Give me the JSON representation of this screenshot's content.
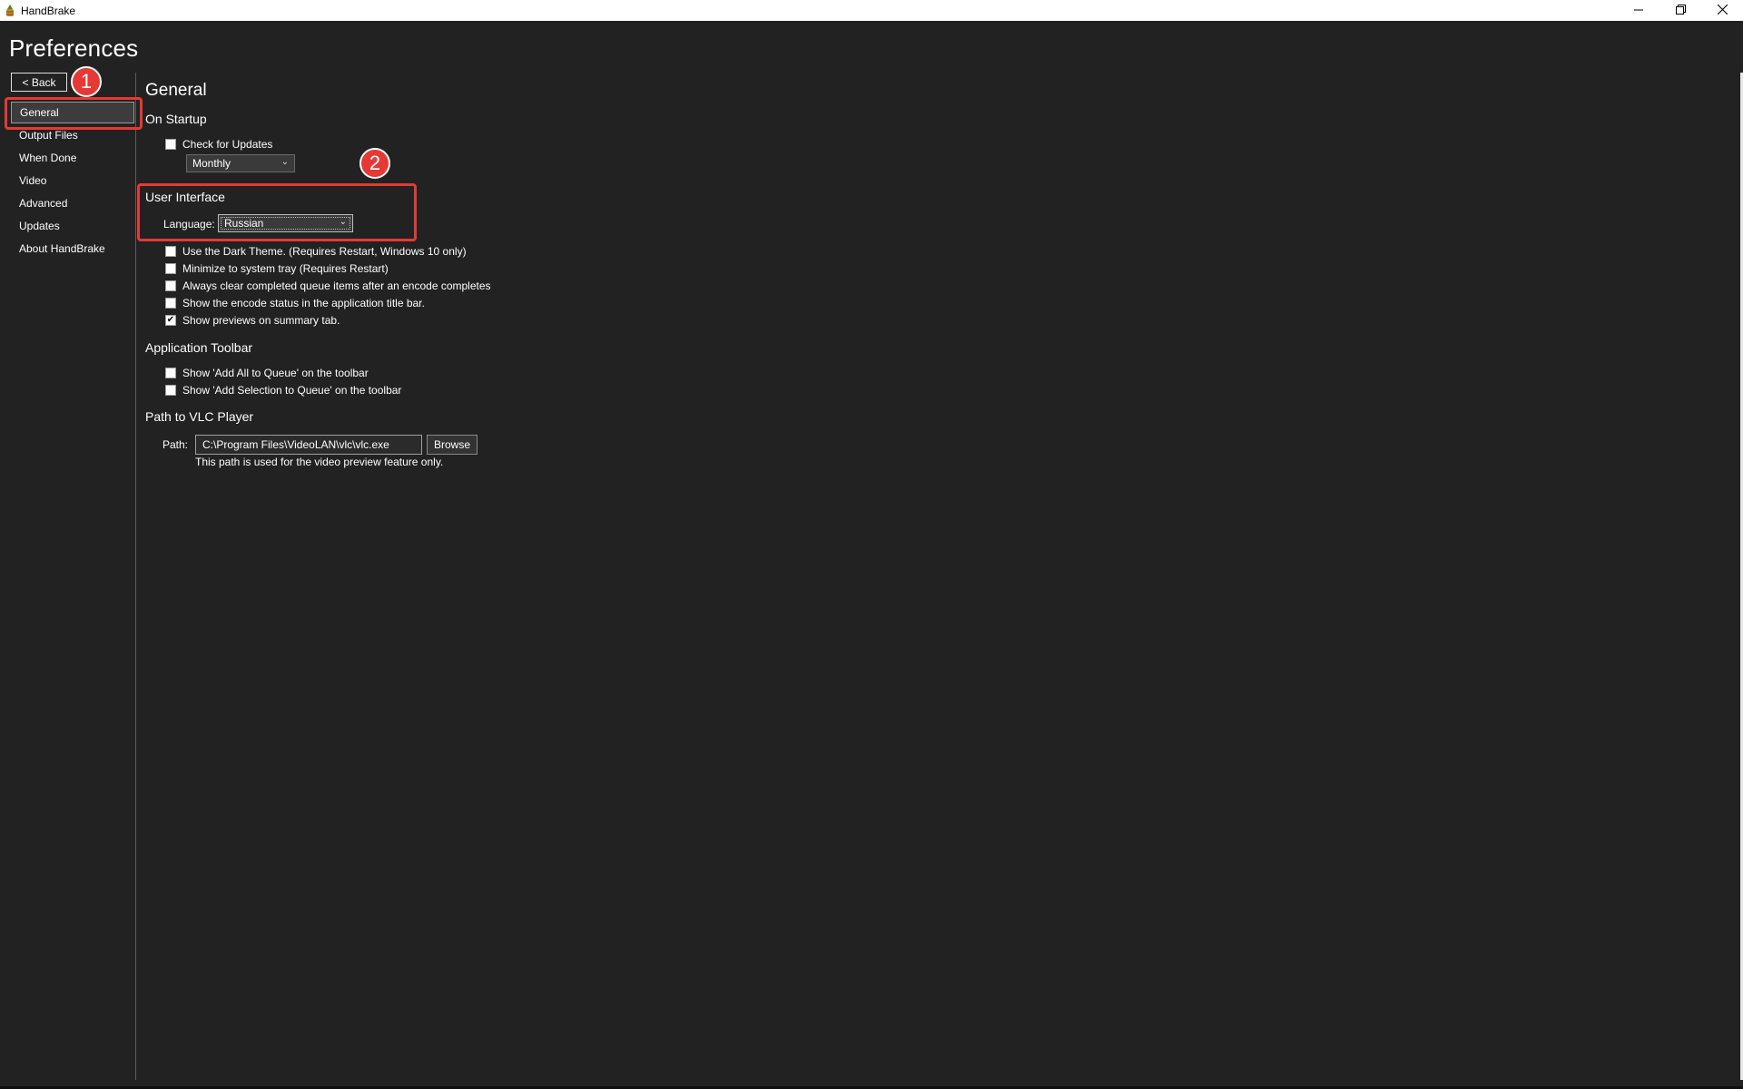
{
  "window": {
    "title": "HandBrake",
    "icon": "handbrake-pineapple-icon",
    "controls": {
      "minimize_icon": "minimize-icon",
      "restore_icon": "restore-icon",
      "close_icon": "close-icon"
    }
  },
  "page_title": "Preferences",
  "back_label": "< Back",
  "badges": {
    "one": "1",
    "two": "2"
  },
  "sidebar": {
    "items": [
      {
        "label": "General",
        "selected": true
      },
      {
        "label": "Output Files"
      },
      {
        "label": "When Done"
      },
      {
        "label": "Video"
      },
      {
        "label": "Advanced"
      },
      {
        "label": "Updates"
      },
      {
        "label": "About HandBrake"
      }
    ]
  },
  "main": {
    "title": "General",
    "on_startup": {
      "heading": "On Startup",
      "check_updates": {
        "label": "Check for Updates",
        "checked": false
      },
      "frequency": {
        "value": "Monthly"
      }
    },
    "user_interface": {
      "heading": "User Interface",
      "language_label": "Language:",
      "language_value": "Russian",
      "options": [
        {
          "label": "Use the Dark Theme. (Requires Restart, Windows 10 only)",
          "checked": false
        },
        {
          "label": "Minimize to system tray (Requires Restart)",
          "checked": false
        },
        {
          "label": "Always clear completed queue items after an encode completes",
          "checked": false
        },
        {
          "label": "Show the encode status in the application title bar.",
          "checked": false
        },
        {
          "label": "Show previews on summary tab.",
          "checked": true
        }
      ]
    },
    "app_toolbar": {
      "heading": "Application Toolbar",
      "options": [
        {
          "label": "Show 'Add All to Queue' on the toolbar",
          "checked": false
        },
        {
          "label": "Show 'Add Selection to Queue' on the toolbar",
          "checked": false
        }
      ]
    },
    "vlc": {
      "heading": "Path to VLC Player",
      "path_label": "Path:",
      "path_value": "C:\\Program Files\\VideoLAN\\vlc\\vlc.exe",
      "browse_label": "Browse",
      "hint": "This path is used for the video preview feature only."
    }
  },
  "colors": {
    "background": "#222222",
    "annotation_red": "#e53935"
  }
}
